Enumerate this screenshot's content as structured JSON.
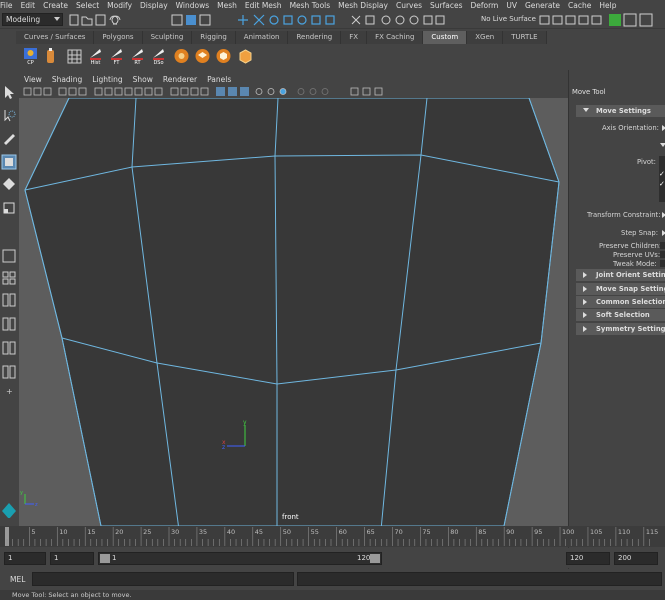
{
  "menubar": {
    "items": [
      "File",
      "Edit",
      "Create",
      "Select",
      "Modify",
      "Display",
      "Windows",
      "Mesh",
      "Edit Mesh",
      "Mesh Tools",
      "Mesh Display",
      "Curves",
      "Surfaces",
      "Deform",
      "UV",
      "Generate",
      "Cache",
      "Help"
    ]
  },
  "statusline": {
    "mode": "Modeling",
    "live_surface": "No Live Surface"
  },
  "shelf": {
    "tabs": [
      "Curves / Surfaces",
      "Polygons",
      "Sculpting",
      "Rigging",
      "Animation",
      "Rendering",
      "FX",
      "FX Caching",
      "Custom",
      "XGen",
      "TURTLE"
    ],
    "active_tab": "Custom",
    "buttons": [
      {
        "label": "CP",
        "icon": "cp-icon",
        "color": "#3a6fd8"
      },
      {
        "label": "",
        "icon": "bottle-icon",
        "color": "#d98a3a"
      },
      {
        "label": "",
        "icon": "grid-icon",
        "color": "#cccccc"
      },
      {
        "label": "Hist",
        "icon": "history-icon",
        "color": "#cc3333"
      },
      {
        "label": "FT",
        "icon": "freeze-icon",
        "color": "#cc3333"
      },
      {
        "label": "RT",
        "icon": "reset-icon",
        "color": "#cc3333"
      },
      {
        "label": "DSo",
        "icon": "dso-icon",
        "color": "#cc3333"
      },
      {
        "label": "",
        "icon": "sphere-orange-icon",
        "color": "#e08020"
      },
      {
        "label": "",
        "icon": "layers-icon",
        "color": "#e08020"
      },
      {
        "label": "",
        "icon": "cube-orange-icon",
        "color": "#e08020"
      },
      {
        "label": "",
        "icon": "cube-outline-icon",
        "color": "#dddddd"
      }
    ]
  },
  "viewport": {
    "menu": [
      "View",
      "Shading",
      "Lighting",
      "Show",
      "Renderer",
      "Panels"
    ],
    "camera_label": "front",
    "bg_color": "#5d5d5d",
    "face_color": "#383838",
    "wire_color": "#6fb7e0"
  },
  "toolsettings": {
    "title": "Move Tool",
    "sections": [
      {
        "label": "Move Settings",
        "expanded": true
      },
      {
        "label": "Joint Orient Settings",
        "expanded": false
      },
      {
        "label": "Move Snap Settings",
        "expanded": false
      },
      {
        "label": "Common Selection Op",
        "expanded": false
      },
      {
        "label": "Soft Selection",
        "expanded": false
      },
      {
        "label": "Symmetry Settings",
        "expanded": false
      }
    ],
    "fields": {
      "axis_orientation": "Axis Orientation:",
      "pivot": "Pivot:",
      "transform_constraint": "Transform Constraint:",
      "step_snap": "Step Snap:",
      "preserve_children": "Preserve Children:",
      "preserve_uvs": "Preserve UVs:",
      "tweak_mode": "Tweak Mode:"
    }
  },
  "timeslider": {
    "ticks": [
      "5",
      "10",
      "15",
      "20",
      "25",
      "30",
      "35",
      "40",
      "45",
      "50",
      "55",
      "60",
      "65",
      "70",
      "75",
      "80",
      "85",
      "90",
      "95",
      "100",
      "105",
      "110",
      "115"
    ],
    "current_frame_marker": "1"
  },
  "range": {
    "start": "1",
    "playback_start": "1",
    "slider_start": "1",
    "slider_end": "120",
    "playback_end": "120",
    "end": "200"
  },
  "mel": {
    "label": "MEL"
  },
  "helpline": {
    "text": "Move Tool: Select an object to move."
  }
}
